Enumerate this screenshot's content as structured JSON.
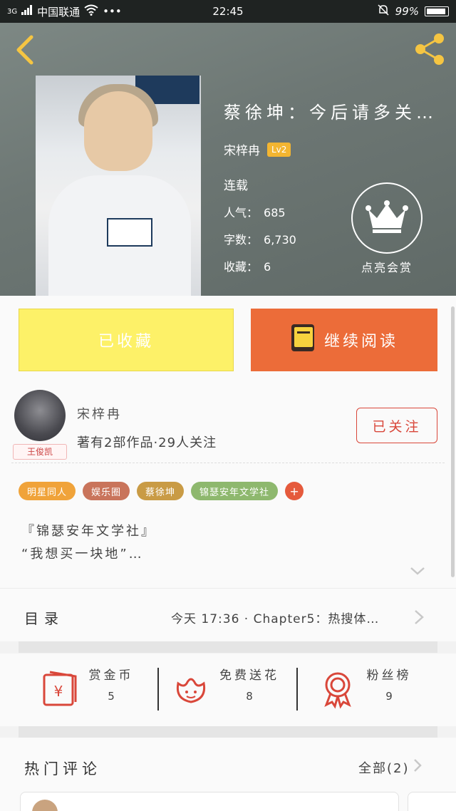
{
  "status_bar": {
    "network": "3G",
    "carrier": "中国联通",
    "time": "22:45",
    "battery": "99%"
  },
  "book": {
    "title": "蔡徐坤：今后请多关…",
    "author": "宋梓冉",
    "level": "Lv2",
    "status": "连载",
    "stats": [
      {
        "label": "人气：",
        "value": "685"
      },
      {
        "label": "字数：",
        "value": "6,730"
      },
      {
        "label": "收藏：",
        "value": "6"
      }
    ],
    "tip_label": "点亮会赏"
  },
  "actions": {
    "collected_label": "已收藏",
    "read_label": "继续阅读"
  },
  "author_panel": {
    "avatar_badge": "王俊凯",
    "name": "宋梓冉",
    "meta": "著有2部作品·29人关注",
    "follow_label": "已关注",
    "tags": [
      {
        "label": "明星同人",
        "color": "#f0a33a"
      },
      {
        "label": "娱乐圈",
        "color": "#c9745b"
      },
      {
        "label": "蔡徐坤",
        "color": "#c99b45"
      },
      {
        "label": "锦瑟安年文学社",
        "color": "#8eb86e"
      }
    ],
    "tag_add": "+",
    "desc_line1": "『锦瑟安年文学社』",
    "desc_line2": "“我想买一块地”…"
  },
  "toc": {
    "label": "目录",
    "latest": "今天 17:36 · Chapter5：热搜体…"
  },
  "rewards": [
    {
      "label": "赏金币",
      "count": "5",
      "icon": "red-envelope-icon"
    },
    {
      "label": "免费送花",
      "count": "8",
      "icon": "flower-icon"
    },
    {
      "label": "粉丝榜",
      "count": "9",
      "icon": "medal-icon"
    }
  ],
  "comments": {
    "title": "热门评论",
    "all_label": "全部(2)",
    "first_name": "",
    "first_time": ""
  },
  "colors": {
    "accent_orange": "#ec6c39",
    "collected_yellow": "#fdf168",
    "follow_red": "#d9473a",
    "level_gold": "#f3b531"
  }
}
